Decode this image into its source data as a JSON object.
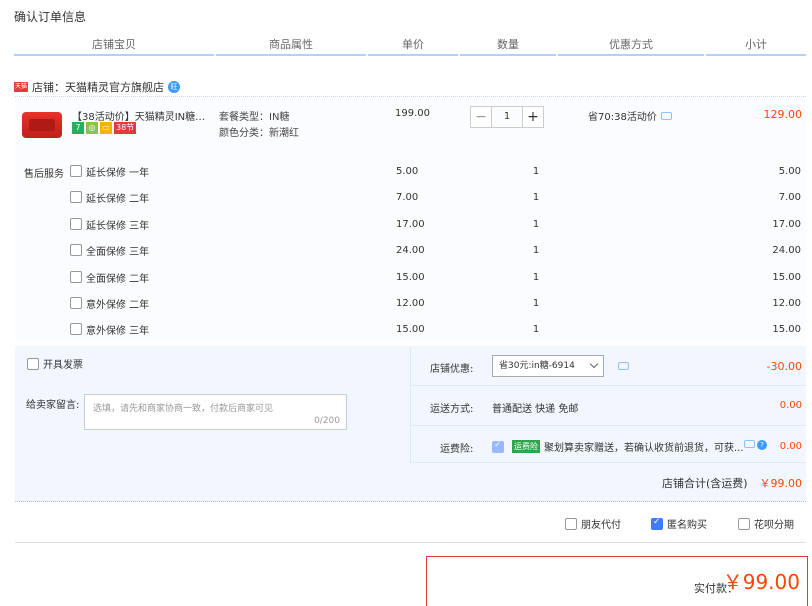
{
  "page": {
    "title": "确认订单信息"
  },
  "columns": [
    "店铺宝贝",
    "商品属性",
    "单价",
    "数量",
    "优惠方式",
    "小计"
  ],
  "shop": {
    "tag": "天猫",
    "name": "店铺：天猫精灵官方旗舰店",
    "ww": "旺"
  },
  "product": {
    "title": "【38活动价】天猫精灵IN糖智...",
    "badges": [
      {
        "text": "7",
        "color": "#1fb35e"
      },
      {
        "text": "◎",
        "color": "#8bc34a"
      },
      {
        "text": "▭",
        "color": "#f5b400"
      },
      {
        "text": "38节",
        "color": "#e4393c"
      }
    ],
    "attr1": "套餐类型：IN糖",
    "attr2": "颜色分类：新潮红",
    "price": "199.00",
    "qty": "1",
    "minus": "−",
    "plus": "+",
    "promo": "省70:38活动价",
    "subtotal": "129.00"
  },
  "service": {
    "label": "售后服务",
    "items": [
      {
        "name": "延长保修 一年",
        "price": "5.00",
        "qty": "1",
        "sub": "5.00"
      },
      {
        "name": "延长保修 二年",
        "price": "7.00",
        "qty": "1",
        "sub": "7.00"
      },
      {
        "name": "延长保修 三年",
        "price": "17.00",
        "qty": "1",
        "sub": "17.00"
      },
      {
        "name": "全面保修 三年",
        "price": "24.00",
        "qty": "1",
        "sub": "24.00"
      },
      {
        "name": "全面保修 二年",
        "price": "15.00",
        "qty": "1",
        "sub": "15.00"
      },
      {
        "name": "意外保修 二年",
        "price": "12.00",
        "qty": "1",
        "sub": "12.00"
      },
      {
        "name": "意外保修 三年",
        "price": "15.00",
        "qty": "1",
        "sub": "15.00"
      }
    ]
  },
  "options": {
    "invoice": "开具发票",
    "message_label": "给卖家留言:",
    "message_placeholder": "选填，请先和商家协商一致，付款后商家可见",
    "message_count": "0/200",
    "shop_discount_label": "店铺优惠:",
    "shop_discount_value": "省30元:in糖-6914",
    "shop_discount_amount": "-30.00",
    "shipping_label": "运送方式:",
    "shipping_value": "普通配送 快递 免邮",
    "shipping_amount": "0.00",
    "freight_label": "运费险:",
    "freight_tag": "运费险",
    "freight_text": "聚划算卖家赠送，若确认收货前退货，可获...",
    "freight_amount": "0.00",
    "shop_total_label": "店铺合计(含运费)",
    "shop_total": "￥99.00"
  },
  "footer": {
    "friend_pay": "朋友代付",
    "anonymous": "匿名购买",
    "huabei": "花呗分期",
    "pay_label": "实付款：",
    "pay_total": "￥99.00"
  }
}
